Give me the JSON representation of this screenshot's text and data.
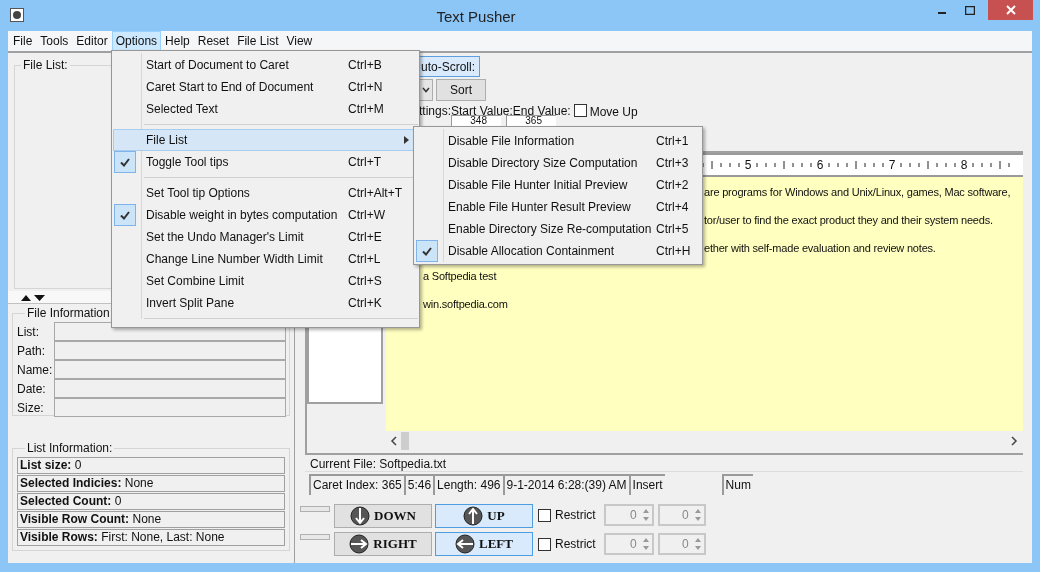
{
  "window": {
    "title": "Text Pusher"
  },
  "menu_bar": [
    {
      "label": "File",
      "selected": false
    },
    {
      "label": "Tools",
      "selected": false
    },
    {
      "label": "Editor",
      "selected": false
    },
    {
      "label": "Options",
      "selected": true
    },
    {
      "label": "Help",
      "selected": false
    },
    {
      "label": "Reset",
      "selected": false
    },
    {
      "label": "File List",
      "selected": false
    },
    {
      "label": "View",
      "selected": false
    }
  ],
  "options_menu": {
    "items": [
      {
        "kind": "item",
        "label": "Start of Document to Caret",
        "shortcut": "Ctrl+B",
        "checked": false,
        "selected": false
      },
      {
        "kind": "item",
        "label": "Caret Start to End of Document",
        "shortcut": "Ctrl+N",
        "checked": false,
        "selected": false
      },
      {
        "kind": "item",
        "label": "Selected Text",
        "shortcut": "Ctrl+M",
        "checked": false,
        "selected": false
      },
      {
        "kind": "separator"
      },
      {
        "kind": "submenu",
        "label": "File List",
        "checked": false,
        "selected": true
      },
      {
        "kind": "item",
        "label": "Toggle Tool tips",
        "shortcut": "Ctrl+T",
        "checked": true,
        "selected": false
      },
      {
        "kind": "separator"
      },
      {
        "kind": "item",
        "label": "Set Tool tip Options",
        "shortcut": "Ctrl+Alt+T",
        "checked": false,
        "selected": false
      },
      {
        "kind": "item",
        "label": "Disable weight in bytes computation",
        "shortcut": "Ctrl+W",
        "checked": true,
        "selected": false
      },
      {
        "kind": "item",
        "label": "Set the Undo Manager's Limit",
        "shortcut": "Ctrl+E",
        "checked": false,
        "selected": false
      },
      {
        "kind": "item",
        "label": "Change Line Number Width Limit",
        "shortcut": "Ctrl+L",
        "checked": false,
        "selected": false
      },
      {
        "kind": "item",
        "label": "Set Combine Limit",
        "shortcut": "Ctrl+S",
        "checked": false,
        "selected": false
      },
      {
        "kind": "item",
        "label": "Invert Split Pane",
        "shortcut": "Ctrl+K",
        "checked": false,
        "selected": false
      },
      {
        "kind": "separator"
      }
    ]
  },
  "file_list_submenu": {
    "items": [
      {
        "label": "Disable File Information",
        "shortcut": "Ctrl+1",
        "checked": false
      },
      {
        "label": "Disable Directory Size Computation",
        "shortcut": "Ctrl+3",
        "checked": false
      },
      {
        "label": "Disable File Hunter Initial Preview",
        "shortcut": "Ctrl+2",
        "checked": false
      },
      {
        "label": "Enable File Hunter Result Preview",
        "shortcut": "Ctrl+4",
        "checked": false
      },
      {
        "label": "Enable Directory Size Re-computation",
        "shortcut": "Ctrl+5",
        "checked": false
      },
      {
        "label": "Disable Allocation Containment",
        "shortcut": "Ctrl+H",
        "checked": true
      }
    ]
  },
  "file_list_panel": {
    "title": "File List:"
  },
  "file_information": {
    "title": "File Information",
    "fields": [
      {
        "label": "List:"
      },
      {
        "label": "Path:"
      },
      {
        "label": "Name:"
      },
      {
        "label": "Date:"
      },
      {
        "label": "Size:"
      }
    ]
  },
  "list_information": {
    "title": "List Information:",
    "rows": [
      {
        "text": "**List size:** 0"
      },
      {
        "text": "**Selected Indicies:** None"
      },
      {
        "text": "**Selected Count:** 0"
      },
      {
        "text": "**Visible Row Count:** None"
      },
      {
        "text": "**Visible Rows:** First: None, Last: None"
      }
    ]
  },
  "controls": {
    "auto_scroll_button": "uto-Scroll:",
    "sort_button": "Sort",
    "settings_label": "ttings:",
    "start_value": {
      "label": "Start Value:",
      "value": "348"
    },
    "end_value": {
      "label": "End Value:",
      "value": "365"
    },
    "move_up": {
      "label": "Move Up",
      "checked": false
    }
  },
  "editor": {
    "ruler_labels": [
      "5",
      "6",
      "7",
      "8"
    ],
    "lines": [
      "are programs for Windows and Unix/Linux, games, Mac software,",
      "tor/user to find the exact product they and their system needs.",
      "ether with self-made evaluation and review notes.",
      "a Softpedia test",
      "win.softpedia.com"
    ]
  },
  "current_file": "Current File: Softpedia.txt",
  "status_bar": [
    {
      "text": "Caret Index: 365"
    },
    {
      "text": "5:46"
    },
    {
      "text": "Length: 496"
    },
    {
      "text": "9-1-2014 6:28:(39) AM"
    },
    {
      "text": "Insert"
    },
    {
      "text": "Num"
    }
  ],
  "direction_buttons": [
    {
      "kind": "down",
      "label": "DOWN",
      "selected": false
    },
    {
      "kind": "up",
      "label": "UP",
      "selected": true
    },
    {
      "kind": "right",
      "label": "RIGHT",
      "selected": false
    },
    {
      "kind": "left",
      "label": "LEFT",
      "selected": true
    }
  ],
  "restrict_rows": [
    {
      "label": "Restrict",
      "checked": false,
      "min": "0",
      "max": "0"
    },
    {
      "label": "Restrict",
      "checked": false,
      "min": "0",
      "max": "0"
    }
  ]
}
